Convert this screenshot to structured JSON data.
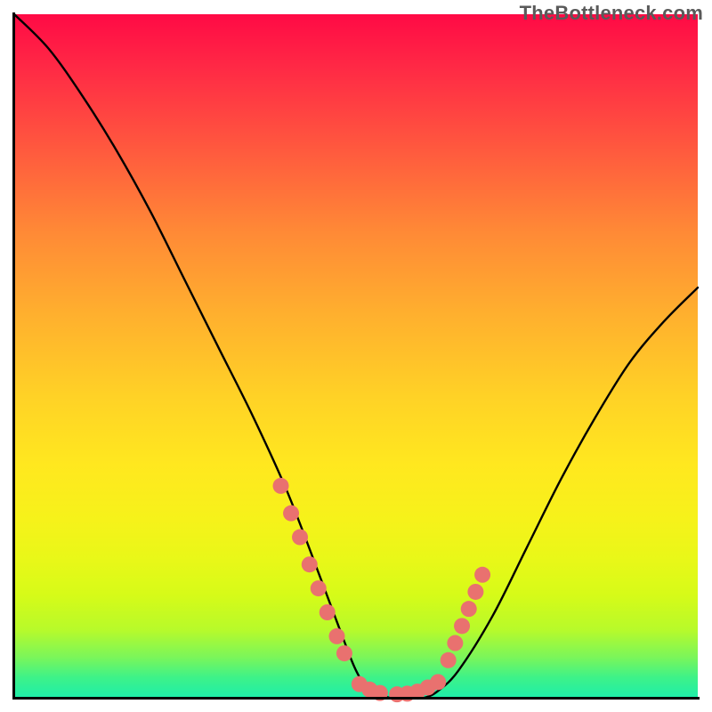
{
  "watermark": "TheBottleneck.com",
  "chart_data": {
    "type": "line",
    "title": "",
    "xlabel": "",
    "ylabel": "",
    "xlim": [
      0,
      100
    ],
    "ylim": [
      0,
      100
    ],
    "grid": false,
    "series": [
      {
        "name": "curve",
        "color": "#000000",
        "x": [
          0,
          5,
          10,
          15,
          20,
          25,
          30,
          35,
          40,
          45,
          48,
          50,
          52,
          55,
          58,
          60,
          62,
          65,
          70,
          75,
          80,
          85,
          90,
          95,
          100
        ],
        "y": [
          100,
          95,
          88,
          80,
          71,
          61,
          51,
          41,
          30,
          17,
          9,
          4,
          1,
          0,
          0,
          0,
          1,
          4,
          12,
          22,
          32,
          41,
          49,
          55,
          60
        ]
      }
    ],
    "markers": {
      "left_cluster": {
        "color": "#e9716f",
        "points": [
          {
            "x": 39.0,
            "y": 31
          },
          {
            "x": 40.5,
            "y": 27
          },
          {
            "x": 41.8,
            "y": 23.5
          },
          {
            "x": 43.2,
            "y": 19.5
          },
          {
            "x": 44.5,
            "y": 16
          },
          {
            "x": 45.8,
            "y": 12.5
          },
          {
            "x": 47.2,
            "y": 9
          },
          {
            "x": 48.3,
            "y": 6.5
          }
        ]
      },
      "flat_cluster": {
        "color": "#e9716f",
        "points": [
          {
            "x": 50.5,
            "y": 2.0
          },
          {
            "x": 52.0,
            "y": 1.2
          },
          {
            "x": 53.5,
            "y": 0.7
          },
          {
            "x": 56.0,
            "y": 0.5
          },
          {
            "x": 57.5,
            "y": 0.6
          },
          {
            "x": 59.0,
            "y": 0.9
          },
          {
            "x": 60.5,
            "y": 1.5
          },
          {
            "x": 62.0,
            "y": 2.3
          }
        ]
      },
      "right_cluster": {
        "color": "#e9716f",
        "points": [
          {
            "x": 63.5,
            "y": 5.5
          },
          {
            "x": 64.5,
            "y": 8
          },
          {
            "x": 65.5,
            "y": 10.5
          },
          {
            "x": 66.5,
            "y": 13
          },
          {
            "x": 67.5,
            "y": 15.5
          },
          {
            "x": 68.5,
            "y": 18
          }
        ]
      }
    }
  }
}
